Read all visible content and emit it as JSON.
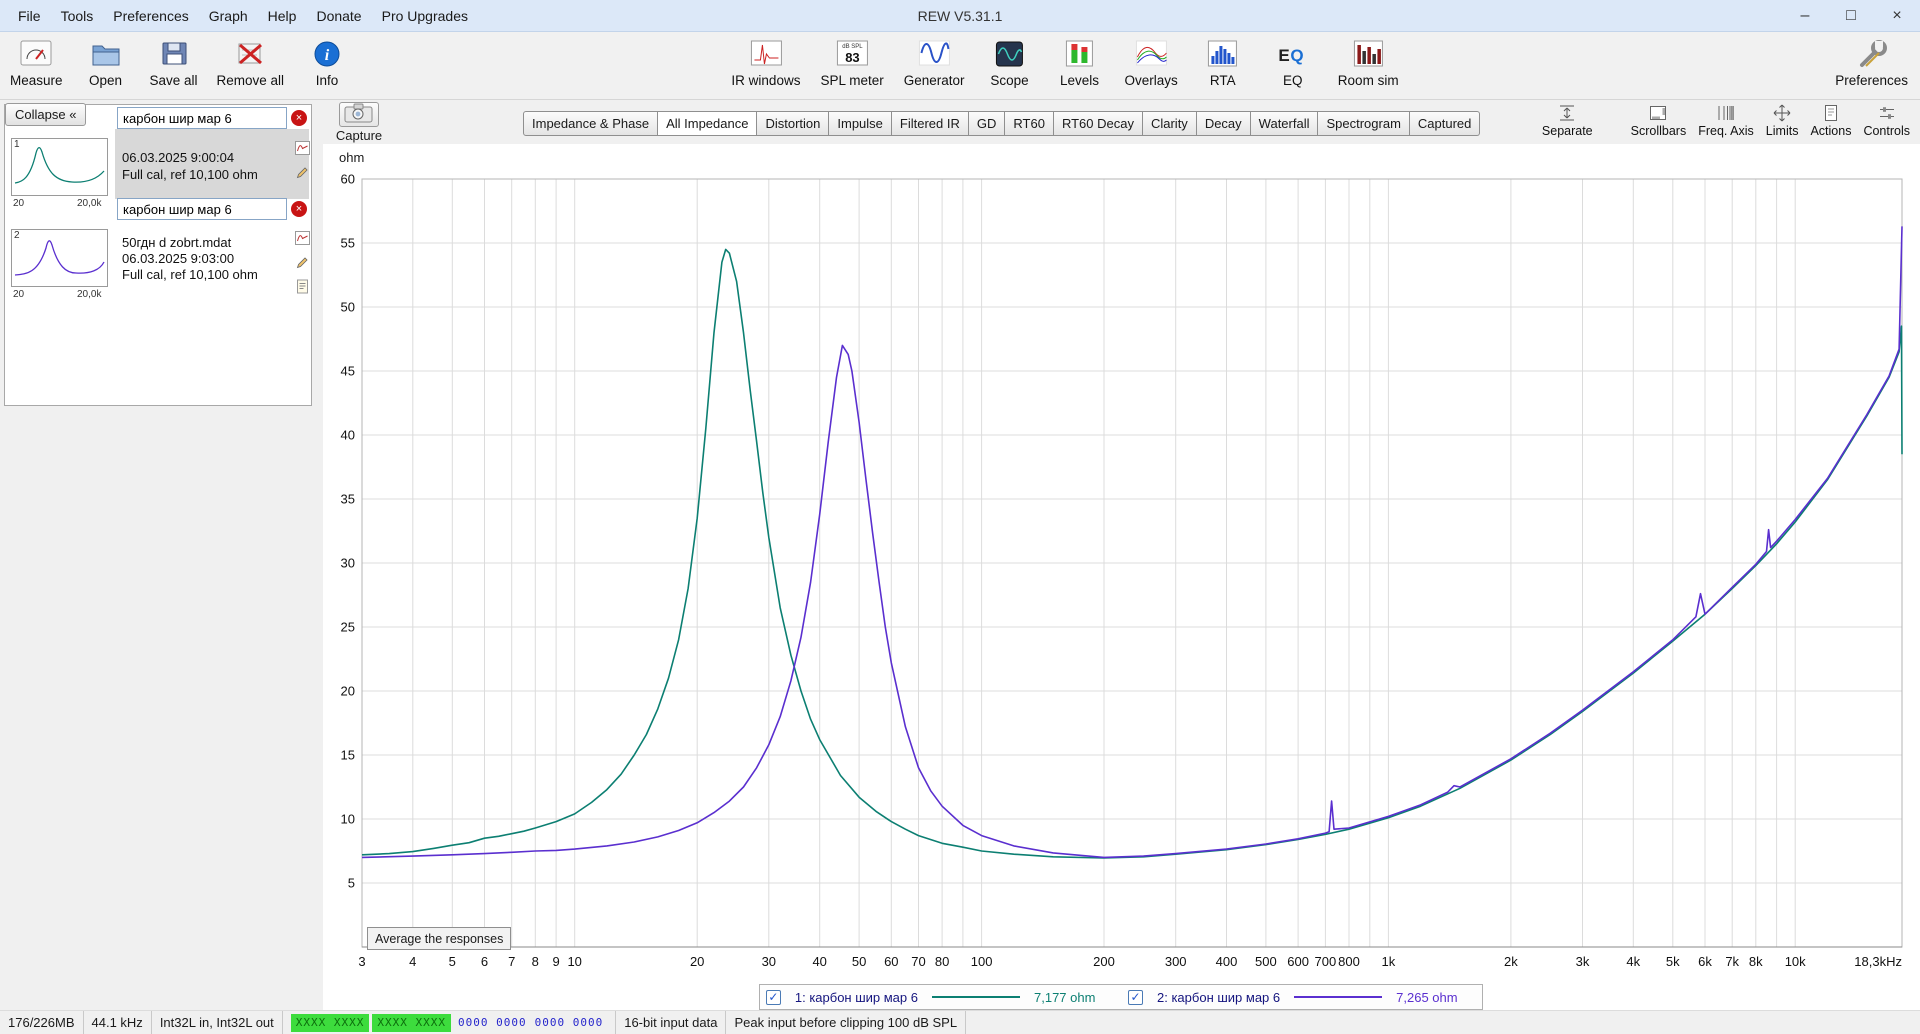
{
  "window": {
    "title": "REW V5.31.1",
    "minimize": "–",
    "maximize": "□",
    "close": "×"
  },
  "menu": {
    "items": [
      "File",
      "Tools",
      "Preferences",
      "Graph",
      "Help",
      "Donate",
      "Pro Upgrades"
    ]
  },
  "toolbar": {
    "measure": "Measure",
    "open": "Open",
    "save_all": "Save all",
    "remove_all": "Remove all",
    "info": "Info",
    "ir_windows": "IR windows",
    "spl_meter": "SPL meter",
    "spl_caption": "dB SPL",
    "spl_value": "83",
    "generator": "Generator",
    "scope": "Scope",
    "levels": "Levels",
    "overlays": "Overlays",
    "rta": "RTA",
    "eq": "EQ",
    "eq_e": "E",
    "eq_q": "Q",
    "room_sim": "Room sim",
    "preferences": "Preferences"
  },
  "sidebar": {
    "collapse": "Collapse «",
    "delete_glyph": "×",
    "m1": {
      "num": "1",
      "name": "карбон шир мар 6",
      "date": "06.03.2025 9:00:04",
      "cal": "Full cal, ref 10,100 ohm",
      "fmin": "20",
      "fmax": "20,0k"
    },
    "m2": {
      "num": "2",
      "name": "карбон шир мар 6",
      "file": "50гдн d zobrt.mdat",
      "date": "06.03.2025 9:03:00",
      "cal": "Full cal, ref 10,100 ohm",
      "fmin": "20",
      "fmax": "20,0k"
    }
  },
  "graph": {
    "capture": "Capture",
    "ylabel": "ohm",
    "tabs": [
      "Impedance & Phase",
      "All Impedance",
      "Distortion",
      "Impulse",
      "Filtered IR",
      "GD",
      "RT60",
      "RT60 Decay",
      "Clarity",
      "Decay",
      "Waterfall",
      "Spectrogram",
      "Captured"
    ],
    "selected_tab": "All Impedance",
    "buttons": {
      "separate": "Separate",
      "scrollbars": "Scrollbars",
      "freq_axis": "Freq. Axis",
      "limits": "Limits",
      "actions": "Actions",
      "controls": "Controls"
    },
    "average": "Average the responses"
  },
  "chart_data": {
    "type": "line",
    "x_scale": "log",
    "xlabel": "Frequency (Hz)",
    "ylabel": "ohm",
    "xlim": [
      3,
      18300
    ],
    "ylim": [
      0,
      60
    ],
    "grid": true,
    "y_ticks": [
      5,
      10,
      15,
      20,
      25,
      30,
      35,
      40,
      45,
      50,
      55,
      60
    ],
    "x_ticks": [
      {
        "f": 3,
        "label": "3"
      },
      {
        "f": 4,
        "label": "4"
      },
      {
        "f": 5,
        "label": "5"
      },
      {
        "f": 6,
        "label": "6"
      },
      {
        "f": 7,
        "label": "7"
      },
      {
        "f": 8,
        "label": "8"
      },
      {
        "f": 9,
        "label": "9"
      },
      {
        "f": 10,
        "label": "10"
      },
      {
        "f": 20,
        "label": "20"
      },
      {
        "f": 30,
        "label": "30"
      },
      {
        "f": 40,
        "label": "40"
      },
      {
        "f": 50,
        "label": "50"
      },
      {
        "f": 60,
        "label": "60"
      },
      {
        "f": 70,
        "label": "70"
      },
      {
        "f": 80,
        "label": "80"
      },
      {
        "f": 100,
        "label": "100"
      },
      {
        "f": 200,
        "label": "200"
      },
      {
        "f": 300,
        "label": "300"
      },
      {
        "f": 400,
        "label": "400"
      },
      {
        "f": 500,
        "label": "500"
      },
      {
        "f": 600,
        "label": "600"
      },
      {
        "f": 700,
        "label": "700"
      },
      {
        "f": 800,
        "label": "800"
      },
      {
        "f": 1000,
        "label": "1k"
      },
      {
        "f": 2000,
        "label": "2k"
      },
      {
        "f": 3000,
        "label": "3k"
      },
      {
        "f": 4000,
        "label": "4k"
      },
      {
        "f": 5000,
        "label": "5k"
      },
      {
        "f": 6000,
        "label": "6k"
      },
      {
        "f": 7000,
        "label": "7k"
      },
      {
        "f": 8000,
        "label": "8k"
      },
      {
        "f": 10000,
        "label": "10k"
      },
      {
        "f": 18300,
        "label": "18,3kHz",
        "anchor": "end"
      }
    ],
    "x_grid_extra": [
      90,
      900,
      9000
    ],
    "series": [
      {
        "name": "1: карбон шир мар 6",
        "color": "#0c7f72",
        "value_label": "7,177 ohm",
        "points": [
          [
            3,
            7.2
          ],
          [
            3.5,
            7.3
          ],
          [
            4,
            7.45
          ],
          [
            4.5,
            7.7
          ],
          [
            5,
            7.95
          ],
          [
            5.5,
            8.15
          ],
          [
            6,
            8.5
          ],
          [
            6.5,
            8.65
          ],
          [
            7,
            8.85
          ],
          [
            7.5,
            9.05
          ],
          [
            8,
            9.3
          ],
          [
            9,
            9.8
          ],
          [
            10,
            10.4
          ],
          [
            11,
            11.3
          ],
          [
            12,
            12.3
          ],
          [
            13,
            13.5
          ],
          [
            14,
            15
          ],
          [
            15,
            16.6
          ],
          [
            16,
            18.6
          ],
          [
            17,
            21
          ],
          [
            18,
            24
          ],
          [
            19,
            28
          ],
          [
            20,
            33.5
          ],
          [
            21,
            40.5
          ],
          [
            22,
            48
          ],
          [
            23,
            53.5
          ],
          [
            23.5,
            54.5
          ],
          [
            24,
            54.2
          ],
          [
            25,
            52
          ],
          [
            26,
            48
          ],
          [
            27,
            43.5
          ],
          [
            28,
            39.5
          ],
          [
            29,
            35.5
          ],
          [
            30,
            32
          ],
          [
            32,
            26.5
          ],
          [
            34,
            22.8
          ],
          [
            36,
            20
          ],
          [
            38,
            17.8
          ],
          [
            40,
            16.2
          ],
          [
            45,
            13.4
          ],
          [
            50,
            11.7
          ],
          [
            55,
            10.6
          ],
          [
            60,
            9.8
          ],
          [
            65,
            9.2
          ],
          [
            70,
            8.7
          ],
          [
            80,
            8.1
          ],
          [
            90,
            7.8
          ],
          [
            100,
            7.5
          ],
          [
            120,
            7.25
          ],
          [
            150,
            7.05
          ],
          [
            200,
            6.95
          ],
          [
            250,
            7.05
          ],
          [
            300,
            7.25
          ],
          [
            400,
            7.6
          ],
          [
            500,
            8
          ],
          [
            600,
            8.4
          ],
          [
            700,
            8.8
          ],
          [
            800,
            9.2
          ],
          [
            1000,
            10.1
          ],
          [
            1200,
            11
          ],
          [
            1500,
            12.4
          ],
          [
            2000,
            14.6
          ],
          [
            2500,
            16.6
          ],
          [
            3000,
            18.4
          ],
          [
            4000,
            21.4
          ],
          [
            5000,
            23.9
          ],
          [
            6000,
            26
          ],
          [
            7000,
            28
          ],
          [
            8000,
            29.8
          ],
          [
            9000,
            31.5
          ],
          [
            10000,
            33.2
          ],
          [
            12000,
            36.5
          ],
          [
            15000,
            41.5
          ],
          [
            17000,
            44.5
          ],
          [
            18000,
            46.5
          ],
          [
            18250,
            48.5
          ],
          [
            18300,
            38.5
          ]
        ]
      },
      {
        "name": "2: карбон шир мар 6",
        "color": "#5a2fcf",
        "value_label": "7,265 ohm",
        "points": [
          [
            3,
            7
          ],
          [
            4,
            7.1
          ],
          [
            5,
            7.2
          ],
          [
            6,
            7.3
          ],
          [
            7,
            7.4
          ],
          [
            8,
            7.5
          ],
          [
            9,
            7.55
          ],
          [
            10,
            7.65
          ],
          [
            12,
            7.9
          ],
          [
            14,
            8.2
          ],
          [
            16,
            8.6
          ],
          [
            18,
            9.1
          ],
          [
            20,
            9.7
          ],
          [
            22,
            10.5
          ],
          [
            24,
            11.4
          ],
          [
            26,
            12.5
          ],
          [
            28,
            14
          ],
          [
            30,
            15.8
          ],
          [
            32,
            18
          ],
          [
            34,
            20.8
          ],
          [
            36,
            24.2
          ],
          [
            38,
            28.5
          ],
          [
            40,
            33.8
          ],
          [
            42,
            39.5
          ],
          [
            44,
            44.5
          ],
          [
            45.5,
            47
          ],
          [
            47,
            46.3
          ],
          [
            48,
            45
          ],
          [
            50,
            41
          ],
          [
            52,
            36.5
          ],
          [
            54,
            32.3
          ],
          [
            56,
            28.5
          ],
          [
            58,
            25
          ],
          [
            60,
            22.2
          ],
          [
            65,
            17.2
          ],
          [
            70,
            14
          ],
          [
            75,
            12.2
          ],
          [
            80,
            11
          ],
          [
            90,
            9.5
          ],
          [
            100,
            8.7
          ],
          [
            120,
            7.9
          ],
          [
            150,
            7.35
          ],
          [
            200,
            7
          ],
          [
            250,
            7.1
          ],
          [
            300,
            7.3
          ],
          [
            400,
            7.65
          ],
          [
            500,
            8.05
          ],
          [
            600,
            8.45
          ],
          [
            700,
            8.9
          ],
          [
            715,
            9
          ],
          [
            725,
            11.4
          ],
          [
            735,
            9.2
          ],
          [
            800,
            9.3
          ],
          [
            1000,
            10.2
          ],
          [
            1200,
            11.1
          ],
          [
            1400,
            12.1
          ],
          [
            1450,
            12.6
          ],
          [
            1500,
            12.5
          ],
          [
            2000,
            14.7
          ],
          [
            2500,
            16.7
          ],
          [
            3000,
            18.5
          ],
          [
            4000,
            21.5
          ],
          [
            5000,
            24
          ],
          [
            5700,
            25.8
          ],
          [
            5850,
            27.6
          ],
          [
            6000,
            26
          ],
          [
            7000,
            28.1
          ],
          [
            8000,
            29.9
          ],
          [
            8500,
            30.9
          ],
          [
            8600,
            32.6
          ],
          [
            8700,
            31.2
          ],
          [
            9000,
            31.7
          ],
          [
            10000,
            33.4
          ],
          [
            12000,
            36.6
          ],
          [
            15000,
            41.6
          ],
          [
            17000,
            44.6
          ],
          [
            18000,
            46.7
          ],
          [
            18300,
            56.3
          ]
        ]
      }
    ]
  },
  "legend": {
    "check_glyph": "✓",
    "item1": {
      "checked": true,
      "label": "1: карбон шир мар 6",
      "value": "7,177 ohm"
    },
    "item2": {
      "checked": true,
      "label": "2: карбон шир мар 6",
      "value": "7,265 ohm"
    }
  },
  "statusbar": {
    "memory": "176/226MB",
    "rate": "44.1 kHz",
    "io": "Int32L in, Int32L out",
    "in1": "XXXX XXXX",
    "in2": "XXXX XXXX",
    "out1": "0000 0000",
    "out2": "0000 0000",
    "bits": "16-bit input data",
    "peak": "Peak input before clipping 100 dB SPL"
  }
}
